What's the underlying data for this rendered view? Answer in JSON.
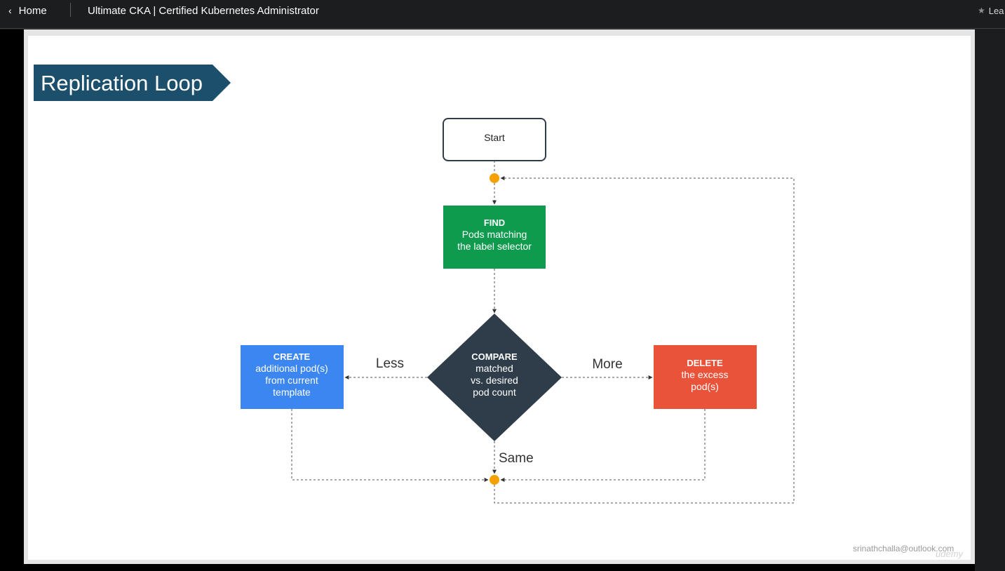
{
  "topbar": {
    "back_label": "Home",
    "course_title": "Ultimate CKA | Certified Kubernetes Administrator",
    "leave_rating_label": "Lea"
  },
  "slide": {
    "title": "Replication Loop",
    "start_label": "Start",
    "find": {
      "heading": "FIND",
      "line1": "Pods matching",
      "line2": "the label selector"
    },
    "compare": {
      "heading": "COMPARE",
      "line1": "matched",
      "line2": "vs. desired",
      "line3": "pod count"
    },
    "create": {
      "heading": "CREATE",
      "line1": "additional pod(s)",
      "line2": "from current",
      "line3": "template"
    },
    "delete": {
      "heading": "DELETE",
      "line1": "the excess",
      "line2": "pod(s)"
    },
    "edge_less": "Less",
    "edge_more": "More",
    "edge_same": "Same",
    "watermark": "srinathchalla@outlook.com",
    "udemy_mark": "udemy"
  },
  "colors": {
    "title_banner": "#1b4f6b",
    "find": "#0e9b4e",
    "compare": "#2f3d4a",
    "create": "#3b86f0",
    "delete": "#e8533a",
    "junction": "#f5a200"
  },
  "icons": {
    "back": "chevron-left-icon",
    "rating": "star-icon"
  }
}
